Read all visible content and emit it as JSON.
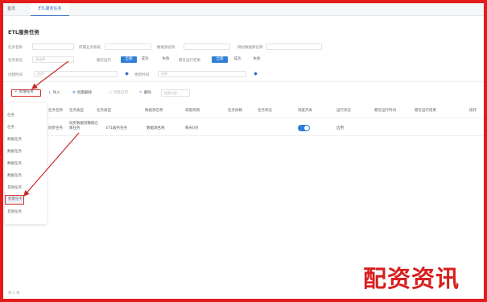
{
  "tabs": {
    "home": "首页",
    "active": "ETL服务任务"
  },
  "page_title": "ETL服务任务",
  "filters": {
    "row1": [
      {
        "label": "任务名称",
        "placeholder": ""
      },
      {
        "label": "所属业务系统",
        "placeholder": ""
      },
      {
        "label": "数据源名称",
        "placeholder": ""
      },
      {
        "label": "目标数据库名称",
        "placeholder": ""
      }
    ],
    "row2": {
      "label_a": "任务状态",
      "input_a": "请选择",
      "label_b": "最近运行",
      "seg_b": [
        "全部",
        "成功",
        "失败"
      ],
      "label_c": "最近运行结果",
      "seg_c": [
        "全部",
        "成功",
        "失败"
      ]
    },
    "row3": {
      "label_a": "创建时间",
      "input_a": "选择",
      "label_b": "更新时间",
      "input_b": "选择"
    }
  },
  "toolbar": {
    "new_task": "新增任务",
    "import": "导入",
    "batch": "批量删除",
    "enable": "批量启用",
    "disable": "删除",
    "search_placeholder": "搜索内容"
  },
  "menu_items": [
    "任务",
    "任务",
    "数据任务",
    "数据任务",
    "数据任务",
    "数据任务",
    "其他任务",
    "批量任务",
    "其他任务",
    "数据任务"
  ],
  "table": {
    "headers": [
      "任务名称",
      "任务类型",
      "数据源名称",
      "调度周期",
      "任务依赖",
      "任务状态",
      "调度开关",
      "运行状态",
      "最近运行时间",
      "最近运行结果",
      "操作"
    ],
    "row": {
      "name": "同步任务",
      "desc": "同步数据到数据仓库任务",
      "type": "ETL服务任务",
      "source": "数据源名称",
      "cycle": "每天0点",
      "status": "启用"
    }
  },
  "footer": "共 1 条",
  "watermark": "配资资讯",
  "colors": {
    "accent": "#2f7fd7",
    "frame": "#e31b1b",
    "watermark": "#d81f1f"
  }
}
